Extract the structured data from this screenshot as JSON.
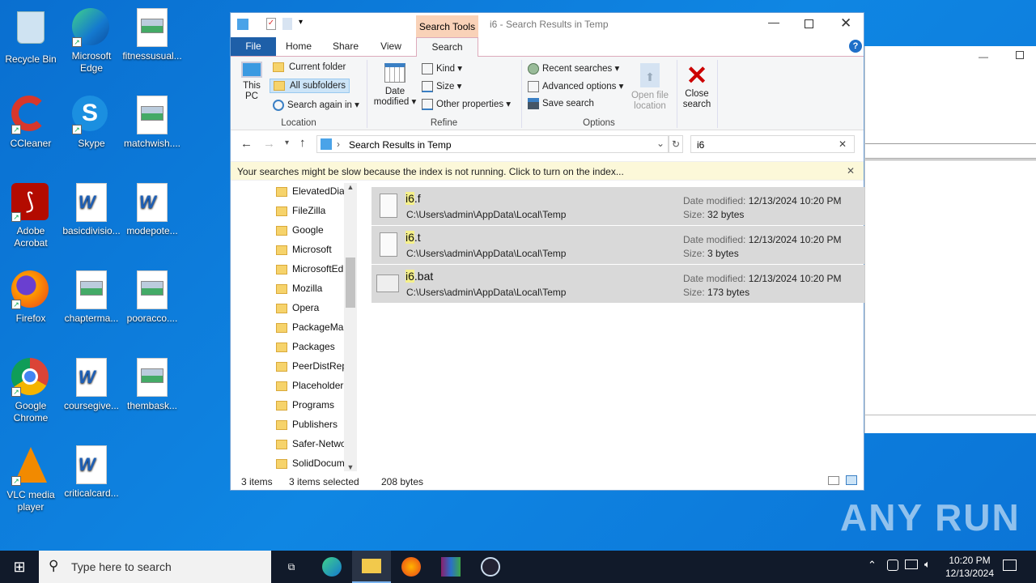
{
  "desktop": {
    "icons": [
      {
        "label": "Recycle Bin",
        "icon": "recycle-bin-icon"
      },
      {
        "label": "Microsoft Edge",
        "icon": "edge-icon"
      },
      {
        "label": "fitnessusual...",
        "icon": "image-file-icon"
      },
      {
        "label": "CCleaner",
        "icon": "ccleaner-icon"
      },
      {
        "label": "Skype",
        "icon": "skype-icon"
      },
      {
        "label": "matchwish....",
        "icon": "image-file-icon"
      },
      {
        "label": "Adobe Acrobat",
        "icon": "acrobat-icon"
      },
      {
        "label": "basicdivisio...",
        "icon": "word-file-icon"
      },
      {
        "label": "modepote...",
        "icon": "word-file-icon"
      },
      {
        "label": "Firefox",
        "icon": "firefox-icon"
      },
      {
        "label": "chapterma...",
        "icon": "image-file-icon"
      },
      {
        "label": "pooracco....",
        "icon": "image-file-icon"
      },
      {
        "label": "Google Chrome",
        "icon": "chrome-icon"
      },
      {
        "label": "coursegive...",
        "icon": "word-file-icon"
      },
      {
        "label": "thembask...",
        "icon": "image-file-icon"
      },
      {
        "label": "VLC media player",
        "icon": "vlc-icon"
      },
      {
        "label": "criticalcard...",
        "icon": "word-file-icon"
      }
    ]
  },
  "explorer": {
    "title": "i6 - Search Results in Temp",
    "context_tab": "Search Tools",
    "tabs": [
      "File",
      "Home",
      "Share",
      "View",
      "Search"
    ],
    "ribbon": {
      "this_pc": "This PC",
      "current_folder": "Current folder",
      "all_subfolders": "All subfolders",
      "search_again": "Search again in",
      "location": "Location",
      "date_modified": "Date modified",
      "kind": "Kind",
      "size": "Size",
      "other_properties": "Other properties",
      "refine": "Refine",
      "recent_searches": "Recent searches",
      "advanced_options": "Advanced options",
      "save_search": "Save search",
      "open_file_location": "Open file location",
      "options": "Options",
      "close_search": "Close search"
    },
    "address": "Search Results in Temp",
    "search_value": "i6",
    "info_bar": "Your searches might be slow because the index is not running.  Click to turn on the index...",
    "nav": [
      "ElevatedDia",
      "FileZilla",
      "Google",
      "Microsoft",
      "MicrosoftEd",
      "Mozilla",
      "Opera",
      "PackageMa",
      "Packages",
      "PeerDistRep",
      "Placeholder",
      "Programs",
      "Publishers",
      "Safer-Netwo",
      "SolidDocum"
    ],
    "results": [
      {
        "match": "i6",
        "rest": ".f",
        "path": "C:\\Users\\admin\\AppData\\Local\\Temp",
        "date_label": "Date modified:",
        "date": "12/13/2024 10:20 PM",
        "size_label": "Size:",
        "size": "32 bytes"
      },
      {
        "match": "i6",
        "rest": ".t",
        "path": "C:\\Users\\admin\\AppData\\Local\\Temp",
        "date_label": "Date modified:",
        "date": "12/13/2024 10:20 PM",
        "size_label": "Size:",
        "size": "3 bytes"
      },
      {
        "match": "i6",
        "rest": ".bat",
        "path": "C:\\Users\\admin\\AppData\\Local\\Temp",
        "date_label": "Date modified:",
        "date": "12/13/2024 10:20 PM",
        "size_label": "Size:",
        "size": "173 bytes"
      }
    ],
    "status": {
      "items": "3 items",
      "selected": "3 items selected",
      "size": "208 bytes"
    }
  },
  "taskbar": {
    "search_placeholder": "Type here to search",
    "time": "10:20 PM",
    "date": "12/13/2024"
  },
  "watermark": "ANY RUN"
}
